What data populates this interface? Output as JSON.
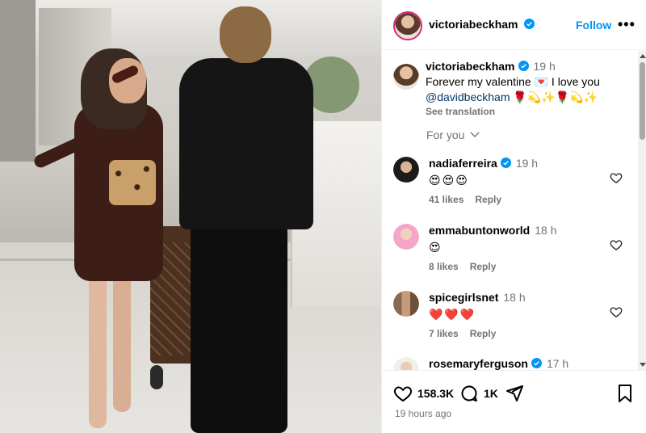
{
  "post": {
    "author": "victoriabeckham",
    "follow_label": "Follow",
    "more_label": "•••",
    "caption_line1": "Forever my valentine 💌  I love you",
    "caption_mention": "@davidbeckham",
    "caption_emojis": " 🌹💫✨🌹💫✨",
    "caption_time": "19 h",
    "see_translation": "See translation",
    "for_you": "For you",
    "posted_ago": "19 hours ago"
  },
  "comments": [
    {
      "user": "nadiaferreira",
      "verified": true,
      "time": "19 h",
      "text": "😍😍😍",
      "likes": "41 likes",
      "reply": "Reply"
    },
    {
      "user": "emmabuntonworld",
      "verified": false,
      "time": "18 h",
      "text": "😍",
      "likes": "8 likes",
      "reply": "Reply"
    },
    {
      "user": "spicegirlsnet",
      "verified": false,
      "time": "18 h",
      "text": "❤️❤️❤️",
      "likes": "7 likes",
      "reply": "Reply"
    },
    {
      "user": "rosemaryferguson",
      "verified": true,
      "time": "17 h",
      "text": "",
      "likes": "",
      "reply": ""
    }
  ],
  "actions": {
    "likes_count": "158.3K",
    "comments_count": "1K"
  },
  "colors": {
    "link_blue": "#0095f6",
    "verified_blue": "#0095f6",
    "muted": "#737373",
    "story_ring": "#d62976"
  },
  "icons": [
    "verified-badge-icon",
    "heart-icon",
    "comment-icon",
    "share-icon",
    "bookmark-icon",
    "chevron-down-icon",
    "more-icon"
  ]
}
